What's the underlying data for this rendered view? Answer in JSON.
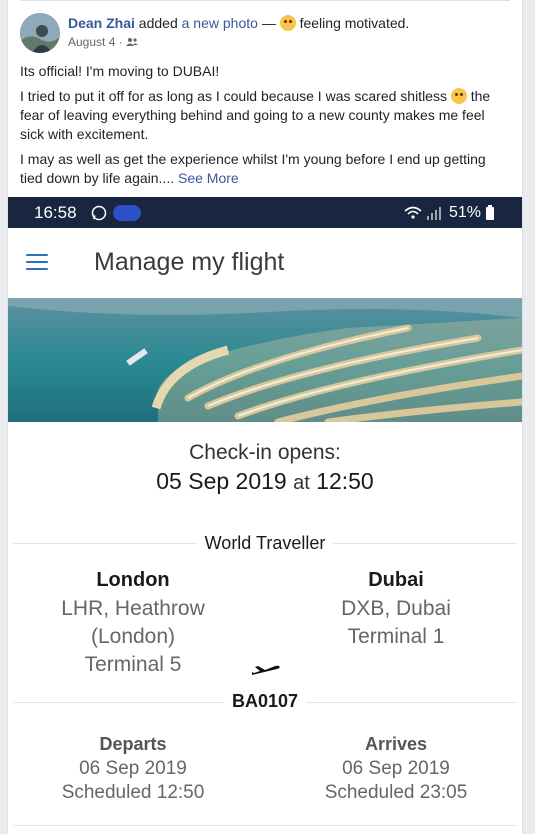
{
  "post": {
    "author": "Dean Zhai",
    "action_pre": "added",
    "action_link": "a new photo",
    "dash": "—",
    "feeling": "feeling motivated.",
    "date": "August 4",
    "sep": "·",
    "paragraphs": [
      "Its official! I'm moving to DUBAI!",
      "I tried to put it off for as long as I could because I was scared shitless",
      "the fear of leaving everything behind and going to a new county makes me feel sick with excitement.",
      "I may as well as get the experience whilst I'm young before I end up getting tied down by life again...."
    ],
    "see_more": "See More"
  },
  "phone": {
    "status": {
      "time": "16:58",
      "battery": "51%"
    },
    "app_title": "Manage my flight",
    "checkin_label": "Check-in opens:",
    "checkin_date": "05 Sep 2019",
    "checkin_at": "at",
    "checkin_time": "12:50",
    "cabin": "World Traveller",
    "from": {
      "city": "London",
      "airport": "LHR, Heathrow",
      "airport2": "(London)",
      "terminal": "Terminal 5"
    },
    "to": {
      "city": "Dubai",
      "airport": "DXB, Dubai",
      "terminal": "Terminal 1"
    },
    "flight_number": "BA0107",
    "departs": {
      "label": "Departs",
      "date": "06 Sep 2019",
      "scheduled": "Scheduled 12:50"
    },
    "arrives": {
      "label": "Arrives",
      "date": "06 Sep 2019",
      "scheduled": "Scheduled 23:05"
    }
  },
  "colors": {
    "fb_link": "#385898",
    "statusbar": "#18263f",
    "menu_icon": "#2f6fbf"
  }
}
